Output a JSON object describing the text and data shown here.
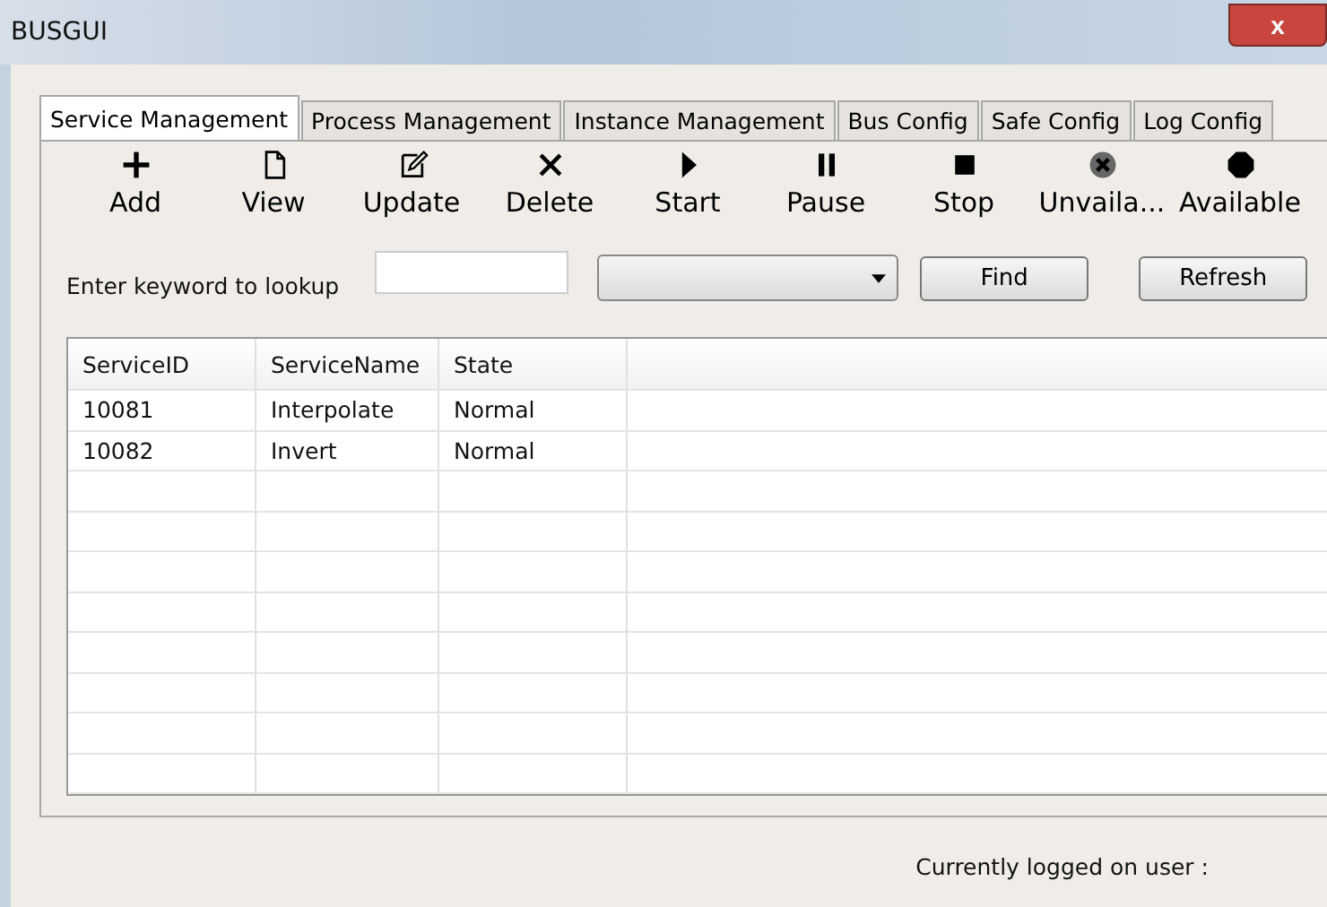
{
  "window": {
    "title": "BUSGUI",
    "close_label": "x"
  },
  "tabs": [
    {
      "label": "Service Management",
      "selected": true
    },
    {
      "label": "Process Management",
      "selected": false
    },
    {
      "label": "Instance Management",
      "selected": false
    },
    {
      "label": "Bus Config",
      "selected": false
    },
    {
      "label": "Safe Config",
      "selected": false
    },
    {
      "label": "Log Config",
      "selected": false
    }
  ],
  "toolbar": [
    {
      "kind": "add",
      "label": "Add"
    },
    {
      "kind": "view",
      "label": "View"
    },
    {
      "kind": "update",
      "label": "Update"
    },
    {
      "kind": "delete",
      "label": "Delete"
    },
    {
      "kind": "start",
      "label": "Start"
    },
    {
      "kind": "pause",
      "label": "Pause"
    },
    {
      "kind": "stop",
      "label": "Stop"
    },
    {
      "kind": "unavailable",
      "label": "Unvaila..."
    },
    {
      "kind": "available",
      "label": "Available"
    }
  ],
  "search": {
    "label": "Enter keyword to lookup",
    "find": "Find",
    "refresh": "Refresh"
  },
  "table": {
    "columns": [
      "ServiceID",
      "ServiceName",
      "State"
    ],
    "rows": [
      [
        "10081",
        "Interpolate",
        "Normal"
      ],
      [
        "10082",
        "Invert",
        "Normal"
      ]
    ]
  },
  "status_bar": {
    "text": "Currently logged on user :"
  }
}
